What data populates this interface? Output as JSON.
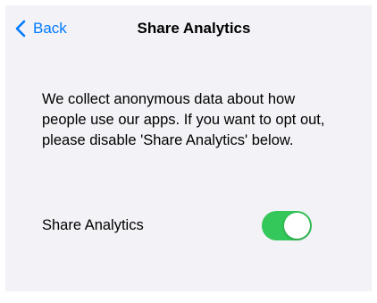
{
  "nav": {
    "back_label": "Back",
    "title": "Share Analytics"
  },
  "content": {
    "description": "We collect anonymous data about how people use our apps. If you want to opt out, please disable 'Share Analytics' below."
  },
  "setting": {
    "label": "Share Analytics",
    "enabled": true
  },
  "colors": {
    "accent": "#007aff",
    "toggle_on": "#34c759",
    "background": "#f2f2f7"
  },
  "icons": {
    "back": "chevron-left-icon"
  }
}
